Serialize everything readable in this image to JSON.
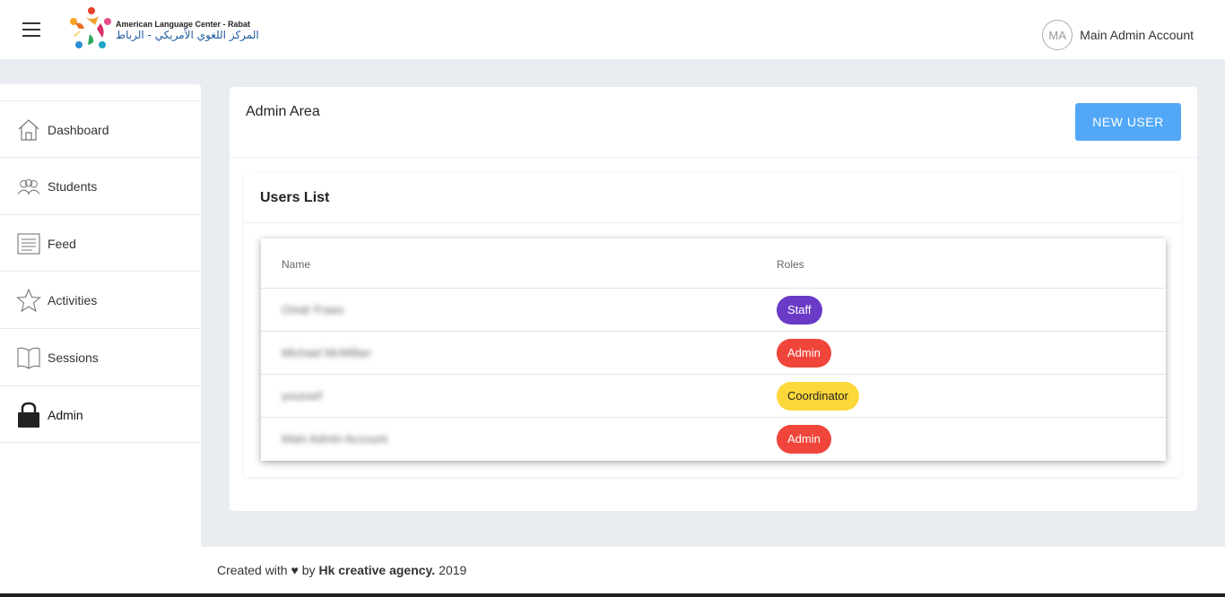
{
  "header": {
    "logo_en": "American Language Center - Rabat",
    "logo_ar": "المركز اللغوي الأمريكي - الرباط",
    "avatar_initials": "MA",
    "user_name": "Main Admin Account"
  },
  "sidebar": {
    "items": [
      {
        "label": "Dashboard",
        "icon": "home-icon"
      },
      {
        "label": "Students",
        "icon": "users-icon"
      },
      {
        "label": "Feed",
        "icon": "feed-icon"
      },
      {
        "label": "Activities",
        "icon": "star-icon"
      },
      {
        "label": "Sessions",
        "icon": "book-icon"
      },
      {
        "label": "Admin",
        "icon": "lock-icon"
      }
    ],
    "active": "Admin"
  },
  "main": {
    "title": "Admin Area",
    "new_user_label": "NEW USER",
    "card_title": "Users List",
    "columns": [
      "Name",
      "Roles"
    ],
    "rows": [
      {
        "name": "Omdr Fraes",
        "role": "Staff",
        "role_color": "#6a3bc6"
      },
      {
        "name": "Michael McMillan",
        "role": "Admin",
        "role_color": "#f0453a"
      },
      {
        "name": "youssef",
        "role": "Coordinator",
        "role_color": "#fdd83a"
      },
      {
        "name": "Main Admin Account",
        "role": "Admin",
        "role_color": "#f0453a"
      }
    ]
  },
  "footer": {
    "prefix": "Created with",
    "heart": "♥",
    "by": "by",
    "agency": "Hk creative agency.",
    "year": "2019"
  },
  "colors": {
    "accent": "#52a8f7",
    "background": "#e9ecf1"
  }
}
